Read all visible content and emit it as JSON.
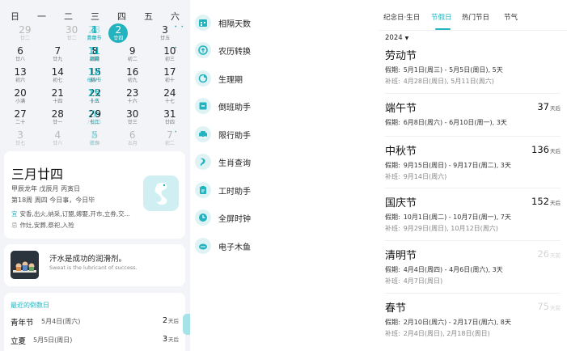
{
  "calendar": {
    "weekdays": [
      "日",
      "一",
      "二",
      "三",
      "四",
      "五",
      "六"
    ],
    "rows": [
      [
        {
          "d": "28",
          "l": "廿",
          "muted": true,
          "hol": true,
          "sup": "休"
        },
        {
          "d": "29",
          "l": "廿二",
          "muted": true
        },
        {
          "d": "30",
          "l": "廿二",
          "muted": true
        },
        {
          "d": "1",
          "l": "劳动节",
          "hol": true,
          "sup": "休"
        },
        {
          "d": "2",
          "l": "廿四",
          "today": true
        },
        {
          "d": "3",
          "l": "廿五",
          "sup": "休"
        },
        {
          "d": "4",
          "l": "青年节",
          "hol": true,
          "sup": "休"
        }
      ],
      [
        {
          "d": "5",
          "l": "立夏",
          "hol": true,
          "sup": "休"
        },
        {
          "d": "6",
          "l": "廿八"
        },
        {
          "d": "7",
          "l": "廿九"
        },
        {
          "d": "8",
          "l": "四月"
        },
        {
          "d": "9",
          "l": "初二"
        },
        {
          "d": "10",
          "l": "初三"
        },
        {
          "d": "11",
          "l": "初四",
          "hol": true,
          "sup": "班"
        }
      ],
      [
        {
          "d": "12",
          "l": "母亲节",
          "hol": true
        },
        {
          "d": "13",
          "l": "初六"
        },
        {
          "d": "14",
          "l": "初七"
        },
        {
          "d": "15",
          "l": "初八"
        },
        {
          "d": "16",
          "l": "初九"
        },
        {
          "d": "17",
          "l": "初十"
        },
        {
          "d": "18",
          "l": "十一",
          "hol": true
        }
      ],
      [
        {
          "d": "19",
          "l": "十二",
          "hol": true
        },
        {
          "d": "20",
          "l": "小满"
        },
        {
          "d": "21",
          "l": "十四"
        },
        {
          "d": "22",
          "l": "十五"
        },
        {
          "d": "23",
          "l": "十六"
        },
        {
          "d": "24",
          "l": "十七"
        },
        {
          "d": "25",
          "l": "十八",
          "hol": true
        }
      ],
      [
        {
          "d": "26",
          "l": "十九",
          "hol": true
        },
        {
          "d": "27",
          "l": "二十"
        },
        {
          "d": "28",
          "l": "廿一"
        },
        {
          "d": "29",
          "l": "廿二"
        },
        {
          "d": "30",
          "l": "廿三"
        },
        {
          "d": "31",
          "l": "廿四"
        },
        {
          "d": "1",
          "l": "儿童节",
          "muted": true,
          "hol": true
        }
      ],
      [
        {
          "d": "2",
          "l": "廿六",
          "muted": true,
          "hol": true
        },
        {
          "d": "3",
          "l": "廿七",
          "muted": true
        },
        {
          "d": "4",
          "l": "廿八",
          "muted": true
        },
        {
          "d": "5",
          "l": "芒种",
          "muted": true
        },
        {
          "d": "6",
          "l": "五月",
          "muted": true
        },
        {
          "d": "7",
          "l": "初二",
          "muted": true
        },
        {
          "d": "8",
          "l": "初三",
          "muted": true,
          "hol": true,
          "sup": "休"
        }
      ]
    ]
  },
  "date_card": {
    "title": "三月廿四",
    "ganzhi": "甲辰龙年 戊辰月 丙寅日",
    "week_info": "第18周 周四 今日事，今日毕",
    "yi_label": "宜",
    "yi_text": "安香,出火,纳采,订盟,嫁娶,开市,立券,交...",
    "ji_label": "忌",
    "ji_text": "作灶,安葬,祭祀,入殓"
  },
  "quote": {
    "cn": "汗水是成功的润滑剂。",
    "en": "Sweat is the lubricant of success."
  },
  "countdown": {
    "header": "最近的倒数日",
    "items": [
      {
        "name": "青年节",
        "date": "5月4日(周六)",
        "days": "2",
        "unit": "天后"
      },
      {
        "name": "立夏",
        "date": "5月5日(周日)",
        "days": "3",
        "unit": "天后"
      }
    ]
  },
  "tools": [
    {
      "label": "相隔天数",
      "icon": "calendar-grid-icon"
    },
    {
      "label": "农历转换",
      "icon": "convert-icon"
    },
    {
      "label": "生理期",
      "icon": "cycle-icon"
    },
    {
      "label": "倒班助手",
      "icon": "shift-icon"
    },
    {
      "label": "限行助手",
      "icon": "car-icon"
    },
    {
      "label": "生肖查询",
      "icon": "zodiac-icon"
    },
    {
      "label": "工时助手",
      "icon": "timesheet-icon"
    },
    {
      "label": "全屏时钟",
      "icon": "clock-icon"
    },
    {
      "label": "电子木鱼",
      "icon": "woodfish-icon"
    }
  ],
  "tabs": [
    {
      "label": "纪念日·生日",
      "active": false
    },
    {
      "label": "节假日",
      "active": true
    },
    {
      "label": "热门节日",
      "active": false
    },
    {
      "label": "节气",
      "active": false
    }
  ],
  "year": "2024",
  "holidays": [
    {
      "name": "劳动节",
      "days": "",
      "unit": "",
      "past": false,
      "vac_label": "假期:",
      "vac": "5月1日(周三) - 5月5日(周日), 5天",
      "work_label": "补班:",
      "work": "4月28日(周日), 5月11日(周六)"
    },
    {
      "name": "端午节",
      "days": "37",
      "unit": "天后",
      "past": false,
      "vac_label": "假期:",
      "vac": "6月8日(周六) - 6月10日(周一), 3天",
      "work_label": "",
      "work": ""
    },
    {
      "name": "中秋节",
      "days": "136",
      "unit": "天后",
      "past": false,
      "vac_label": "假期:",
      "vac": "9月15日(周日) - 9月17日(周二), 3天",
      "work_label": "补班:",
      "work": "9月14日(周六)"
    },
    {
      "name": "国庆节",
      "days": "152",
      "unit": "天后",
      "past": false,
      "vac_label": "假期:",
      "vac": "10月1日(周二) - 10月7日(周一), 7天",
      "work_label": "补班:",
      "work": "9月29日(周日), 10月12日(周六)"
    },
    {
      "name": "清明节",
      "days": "26",
      "unit": "天前",
      "past": true,
      "vac_label": "假期:",
      "vac": "4月4日(周四) - 4月6日(周六), 3天",
      "work_label": "补班:",
      "work": "4月7日(周日)"
    },
    {
      "name": "春节",
      "days": "75",
      "unit": "天前",
      "past": true,
      "vac_label": "假期:",
      "vac": "2月10日(周六) - 2月17日(周六), 8天",
      "work_label": "补班:",
      "work": "2月4日(周日), 2月18日(周日)"
    }
  ],
  "colors": {
    "accent": "#23b3bf",
    "accent_light": "#dff3f5"
  }
}
